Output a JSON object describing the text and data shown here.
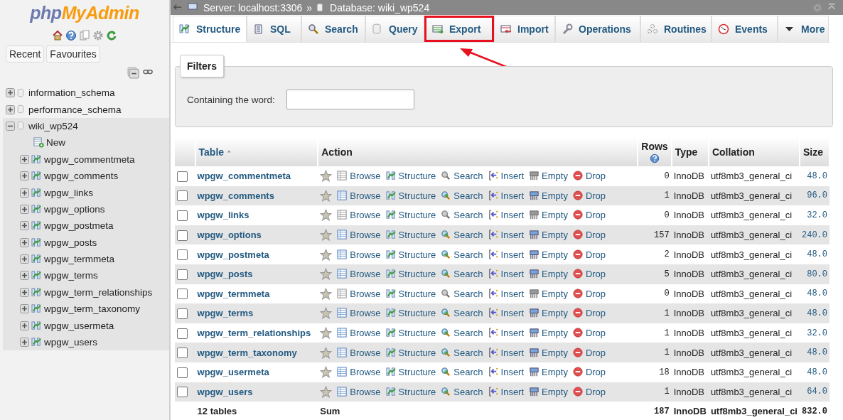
{
  "sidebar": {
    "logo": {
      "text_1": "php",
      "text_2": "MyAdmin"
    },
    "buttons": [
      "Recent",
      "Favourites"
    ],
    "tree": [
      {
        "label": "information_schema",
        "kind": "database",
        "expanded": false,
        "selected": false
      },
      {
        "label": "performance_schema",
        "kind": "database",
        "expanded": false,
        "selected": false
      },
      {
        "label": "wiki_wp524",
        "kind": "database",
        "expanded": true,
        "selected": true,
        "children": [
          {
            "label": "New",
            "kind": "new"
          },
          {
            "label": "wpgw_commentmeta",
            "kind": "table"
          },
          {
            "label": "wpgw_comments",
            "kind": "table"
          },
          {
            "label": "wpgw_links",
            "kind": "table"
          },
          {
            "label": "wpgw_options",
            "kind": "table"
          },
          {
            "label": "wpgw_postmeta",
            "kind": "table"
          },
          {
            "label": "wpgw_posts",
            "kind": "table"
          },
          {
            "label": "wpgw_termmeta",
            "kind": "table"
          },
          {
            "label": "wpgw_terms",
            "kind": "table"
          },
          {
            "label": "wpgw_term_relationships",
            "kind": "table"
          },
          {
            "label": "wpgw_term_taxonomy",
            "kind": "table"
          },
          {
            "label": "wpgw_usermeta",
            "kind": "table"
          },
          {
            "label": "wpgw_users",
            "kind": "table"
          }
        ]
      }
    ]
  },
  "breadcrumb": {
    "server": "Server: localhost:3306",
    "separator": "»",
    "database": "Database: wiki_wp524"
  },
  "tabs": [
    {
      "label": "Structure",
      "selected": true,
      "highlighted": false
    },
    {
      "label": "SQL",
      "selected": false,
      "highlighted": false
    },
    {
      "label": "Search",
      "selected": false,
      "highlighted": false
    },
    {
      "label": "Query",
      "selected": false,
      "highlighted": false
    },
    {
      "label": "Export",
      "selected": false,
      "highlighted": true
    },
    {
      "label": "Import",
      "selected": false,
      "highlighted": false
    },
    {
      "label": "Operations",
      "selected": false,
      "highlighted": false
    },
    {
      "label": "Routines",
      "selected": false,
      "highlighted": false
    },
    {
      "label": "Events",
      "selected": false,
      "highlighted": false
    },
    {
      "label": "More",
      "selected": false,
      "highlighted": false
    }
  ],
  "filters": {
    "legend": "Filters",
    "label": "Containing the word:"
  },
  "table": {
    "columns": [
      "Table",
      "Action",
      "Rows",
      "Type",
      "Collation",
      "Size"
    ],
    "rows": [
      {
        "checked": false,
        "name": "wpgw_commentmeta",
        "actions": [
          "Browse",
          "Structure",
          "Search",
          "Insert",
          "Empty",
          "Drop"
        ],
        "rows": "0",
        "type": "InnoDB",
        "collation": "utf8mb3_general_ci",
        "size": "48.0",
        "has_rows": false
      },
      {
        "checked": false,
        "name": "wpgw_comments",
        "actions": [
          "Browse",
          "Structure",
          "Search",
          "Insert",
          "Empty",
          "Drop"
        ],
        "rows": "1",
        "type": "InnoDB",
        "collation": "utf8mb3_general_ci",
        "size": "96.0",
        "has_rows": true
      },
      {
        "checked": false,
        "name": "wpgw_links",
        "actions": [
          "Browse",
          "Structure",
          "Search",
          "Insert",
          "Empty",
          "Drop"
        ],
        "rows": "0",
        "type": "InnoDB",
        "collation": "utf8mb3_general_ci",
        "size": "32.0",
        "has_rows": false
      },
      {
        "checked": false,
        "name": "wpgw_options",
        "actions": [
          "Browse",
          "Structure",
          "Search",
          "Insert",
          "Empty",
          "Drop"
        ],
        "rows": "157",
        "type": "InnoDB",
        "collation": "utf8mb3_general_ci",
        "size": "240.0",
        "has_rows": true
      },
      {
        "checked": false,
        "name": "wpgw_postmeta",
        "actions": [
          "Browse",
          "Structure",
          "Search",
          "Insert",
          "Empty",
          "Drop"
        ],
        "rows": "2",
        "type": "InnoDB",
        "collation": "utf8mb3_general_ci",
        "size": "48.0",
        "has_rows": true
      },
      {
        "checked": false,
        "name": "wpgw_posts",
        "actions": [
          "Browse",
          "Structure",
          "Search",
          "Insert",
          "Empty",
          "Drop"
        ],
        "rows": "5",
        "type": "InnoDB",
        "collation": "utf8mb3_general_ci",
        "size": "80.0",
        "has_rows": true
      },
      {
        "checked": false,
        "name": "wpgw_termmeta",
        "actions": [
          "Browse",
          "Structure",
          "Search",
          "Insert",
          "Empty",
          "Drop"
        ],
        "rows": "0",
        "type": "InnoDB",
        "collation": "utf8mb3_general_ci",
        "size": "48.0",
        "has_rows": false
      },
      {
        "checked": false,
        "name": "wpgw_terms",
        "actions": [
          "Browse",
          "Structure",
          "Search",
          "Insert",
          "Empty",
          "Drop"
        ],
        "rows": "1",
        "type": "InnoDB",
        "collation": "utf8mb3_general_ci",
        "size": "48.0",
        "has_rows": true
      },
      {
        "checked": false,
        "name": "wpgw_term_relationships",
        "actions": [
          "Browse",
          "Structure",
          "Search",
          "Insert",
          "Empty",
          "Drop"
        ],
        "rows": "1",
        "type": "InnoDB",
        "collation": "utf8mb3_general_ci",
        "size": "32.0",
        "has_rows": true
      },
      {
        "checked": false,
        "name": "wpgw_term_taxonomy",
        "actions": [
          "Browse",
          "Structure",
          "Search",
          "Insert",
          "Empty",
          "Drop"
        ],
        "rows": "1",
        "type": "InnoDB",
        "collation": "utf8mb3_general_ci",
        "size": "48.0",
        "has_rows": true
      },
      {
        "checked": false,
        "name": "wpgw_usermeta",
        "actions": [
          "Browse",
          "Structure",
          "Search",
          "Insert",
          "Empty",
          "Drop"
        ],
        "rows": "18",
        "type": "InnoDB",
        "collation": "utf8mb3_general_ci",
        "size": "48.0",
        "has_rows": true
      },
      {
        "checked": false,
        "name": "wpgw_users",
        "actions": [
          "Browse",
          "Structure",
          "Search",
          "Insert",
          "Empty",
          "Drop"
        ],
        "rows": "1",
        "type": "InnoDB",
        "collation": "utf8mb3_general_ci",
        "size": "64.0",
        "has_rows": true
      }
    ],
    "footer": {
      "count": "12 tables",
      "sum": "Sum",
      "rows": "187",
      "type": "InnoDB",
      "collation": "utf8mb3_general_ci",
      "size": "832.0"
    }
  }
}
